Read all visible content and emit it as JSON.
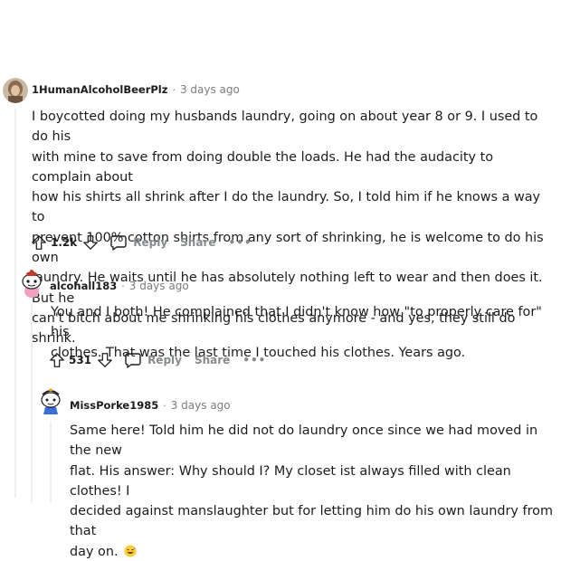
{
  "comments": [
    {
      "author": "1HumanAlcoholBeerPlz",
      "time": "3 days ago",
      "body": "I boycotted doing my husbands laundry, going on about year 8 or 9. I used to do his\nwith mine to save from doing double the loads. He had the audacity to complain about\nhow his shirts all shrink after I do the laundry. So, I told him if he knows a way to\nprevent 100% cotton shirts from any sort of shrinking, he is welcome to do his own\nlaundry. He waits until he has absolutely nothing left to wear and then does it. But he\ncan't bitch about me shrinking his clothes anymore - and yes, they still do shrink.",
      "votes": "1.2k",
      "reply_label": "Reply",
      "share_label": "Share",
      "more_label": "•••"
    },
    {
      "author": "alcohall183",
      "time": "3 days ago",
      "body": "You and I both! He complained that I didn't know how \"to properly care for\" his\nclothes. That was the last time I touched his clothes. Years ago.",
      "votes": "531",
      "reply_label": "Reply",
      "share_label": "Share",
      "more_label": "•••"
    },
    {
      "author": "MissPorke1985",
      "time": "3 days ago",
      "body": "Same here! Told him he did not do laundry once since we had moved in the new\nflat. His answer: Why should I? My closet ist always filled with clean clothes! I\ndecided against manslaughter but for letting him do his own laundry from that\nday on.",
      "emoji": "sweat-smile-emoji"
    }
  ],
  "separator": "·",
  "colors": {
    "text": "#1c1c1c",
    "meta": "#7c7c7c",
    "action": "#878a8c",
    "thread_line": "#edeff1"
  }
}
